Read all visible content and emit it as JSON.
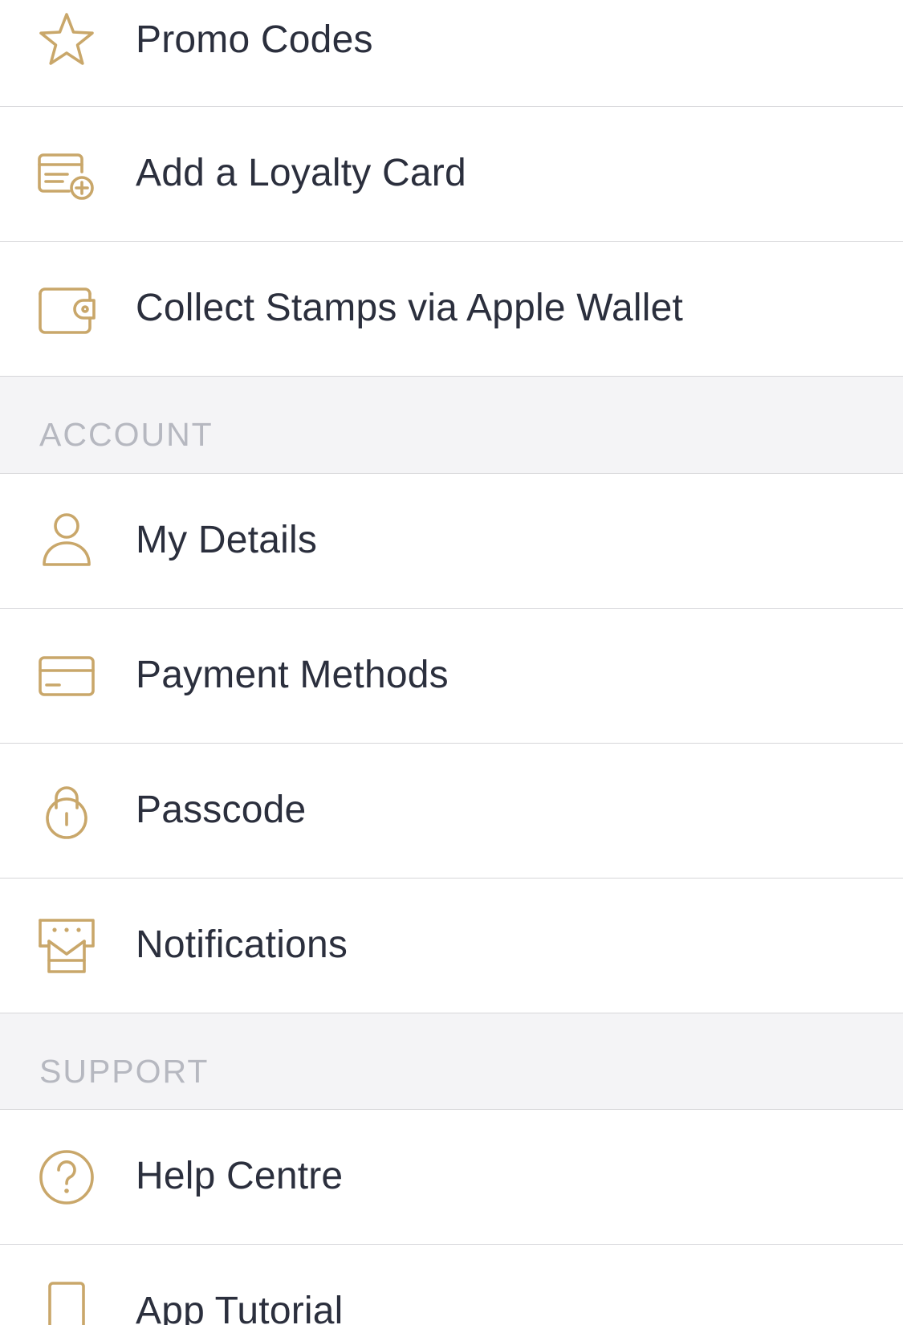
{
  "accent_color": "#c9a76a",
  "text_color": "#2b2f3d",
  "section_text_color": "#b6b8c0",
  "rows_top": [
    {
      "label": "Promo Codes",
      "icon": "star-icon"
    },
    {
      "label": "Add a Loyalty Card",
      "icon": "add-card-icon"
    },
    {
      "label": "Collect Stamps via Apple Wallet",
      "icon": "wallet-icon"
    }
  ],
  "sections": {
    "account": {
      "title": "ACCOUNT"
    },
    "support": {
      "title": "SUPPORT"
    }
  },
  "account_items": [
    {
      "label": "My Details",
      "icon": "user-icon"
    },
    {
      "label": "Payment Methods",
      "icon": "credit-card-icon"
    },
    {
      "label": "Passcode",
      "icon": "padlock-icon"
    },
    {
      "label": "Notifications",
      "icon": "notification-icon"
    }
  ],
  "support_items": [
    {
      "label": "Help Centre",
      "icon": "question-circle-icon"
    },
    {
      "label": "App Tutorial",
      "icon": "phone-icon"
    }
  ]
}
